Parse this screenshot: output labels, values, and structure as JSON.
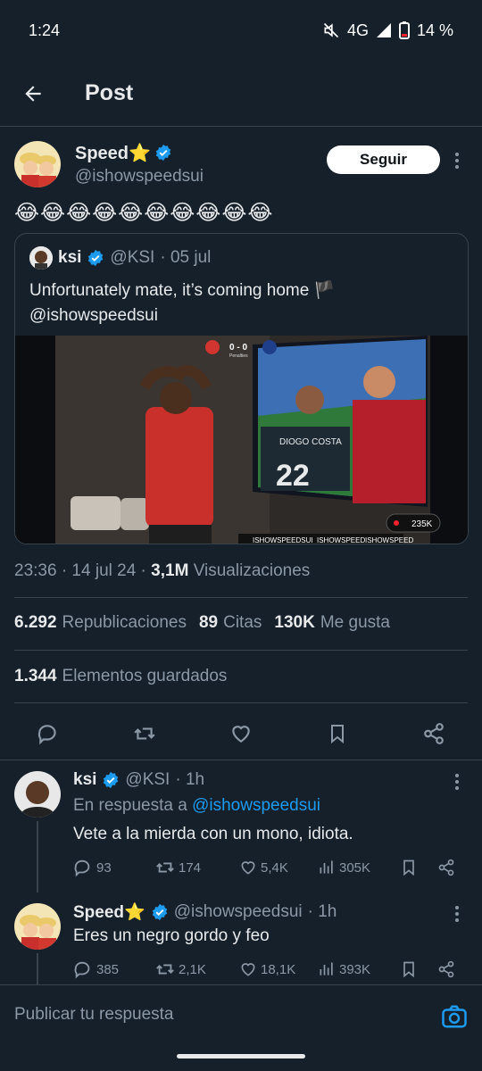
{
  "status": {
    "time": "1:24",
    "network": "4G",
    "battery": "14 %"
  },
  "topbar": {
    "title": "Post"
  },
  "post": {
    "author_name": "Speed⭐",
    "author_handle": "@ishowspeedsui",
    "follow_label": "Seguir",
    "text": "😂😂😂😂😂😂😂😂😂😂",
    "quote": {
      "name": "ksi",
      "handle": "@KSI",
      "date": "· 05 jul",
      "text": "Unfortunately mate, it’s coming home 🏴\n@ishowspeedsui",
      "media": {
        "score": "0 - 0",
        "score_sub": "Penalties",
        "jersey_name": "DIOGO COSTA",
        "jersey_number": "22",
        "viewers": "235K",
        "watermark_1": "ISHOWSPEEDSUI",
        "watermark_2": "ISHOWSPEED",
        "watermark_3": "ISHOWSPEED"
      }
    },
    "time": "23:36 · 14 jul 24 ·",
    "views_count": "3,1M",
    "views_label": "Visualizaciones",
    "reposts_count": "6.292",
    "reposts_label": "Republicaciones",
    "quotes_count": "89",
    "quotes_label": "Citas",
    "likes_count": "130K",
    "likes_label": "Me gusta",
    "saved_count": "1.344",
    "saved_label": "Elementos guardados"
  },
  "replies": [
    {
      "name": "ksi",
      "handle": "@KSI",
      "time": "· 1h",
      "reply_prefix": "En respuesta a",
      "reply_to": "@ishowspeedsui",
      "text": "Vete a la mierda con un mono, idiota.",
      "comments": "93",
      "reposts": "174",
      "likes": "5,4K",
      "views": "305K"
    },
    {
      "name": "Speed⭐",
      "handle": "@ishowspeedsui",
      "time": "· 1h",
      "text": "Eres un negro gordo y feo",
      "comments": "385",
      "reposts": "2,1K",
      "likes": "18,1K",
      "views": "393K"
    }
  ],
  "composer": {
    "placeholder": "Publicar tu respuesta"
  },
  "colors": {
    "bg": "#15202b",
    "accent": "#1d9bf0",
    "muted": "#8b98a5",
    "border": "#38444d"
  }
}
